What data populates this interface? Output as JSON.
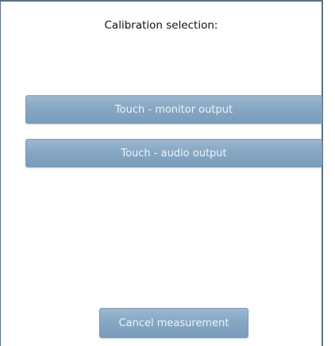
{
  "dialog": {
    "title": "Calibration selection:",
    "options": [
      {
        "label": "Touch - monitor output"
      },
      {
        "label": "Touch - audio output"
      }
    ],
    "cancel_label": "Cancel measurement"
  },
  "colors": {
    "button_fill": "#86a7c3",
    "button_border": "#7f9cb6",
    "button_text": "#eef4f9",
    "frame_border": "#5b6f86"
  }
}
